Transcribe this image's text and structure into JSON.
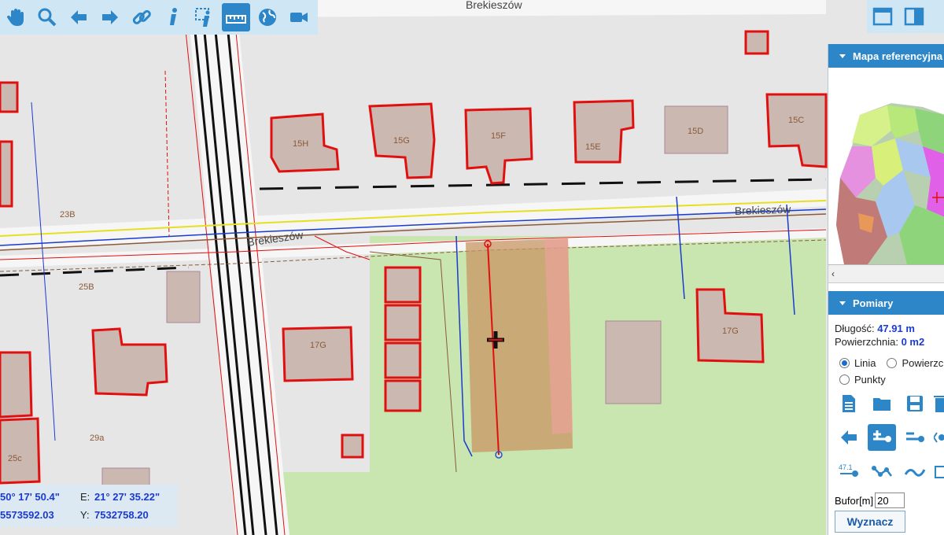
{
  "map": {
    "streets": [
      "Brekieszów",
      "Brekieszów",
      "Brekieszów"
    ],
    "parcels": [
      "15H",
      "15G",
      "15F",
      "15E",
      "15D",
      "15C",
      "23B",
      "25B",
      "17G",
      "17G",
      "29a",
      "25c"
    ]
  },
  "coords": {
    "lat_value": "50° 17' 50.4\"",
    "lon_label": "E:",
    "lon_value": "21° 27' 35.22\"",
    "x_value": "5573592.03",
    "y_label": "Y:",
    "y_value": "7532758.20"
  },
  "panel": {
    "refmap_title": "Mapa referencyjna",
    "measure_title": "Pomiary",
    "length_label": "Długość:",
    "length_value": "47.91 m",
    "area_label": "Powierzchnia:",
    "area_value": "0 m2",
    "mode_line": "Linia",
    "mode_area": "Powierzchnia",
    "mode_points": "Punkty",
    "tool_label_47": "47.1",
    "buffer_label": "Bufor[m]",
    "buffer_value": "20",
    "compute_label": "Wyznacz"
  },
  "colors": {
    "accent": "#2d86c8",
    "measure_line": "#e01010",
    "value_text": "#1a3bd0"
  }
}
